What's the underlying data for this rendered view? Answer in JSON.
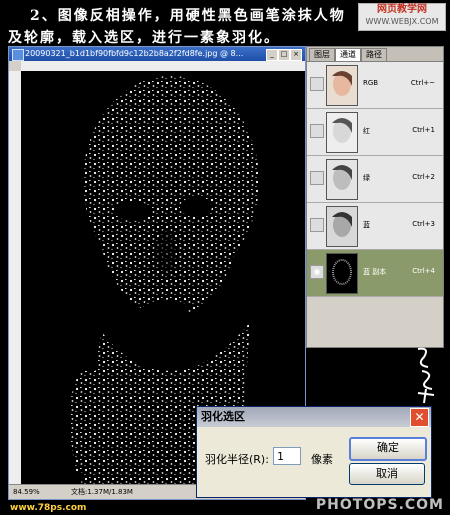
{
  "instruction": {
    "line1": "2、图像反相操作，用硬性黑色画笔涂抹人物",
    "line2": "及轮廓，载入选区，进行一素象羽化。"
  },
  "watermarks": {
    "top_site": "网页教学网",
    "top_url": "WWW.WEBJX.COM",
    "bottom_left": "www.78ps.com",
    "bottom_right": "PHOTOPS.COM"
  },
  "image_window": {
    "title": "20090321_b1d1bf90fbfd9c12b2b8a2f2fd8fe.jpg @ 8...",
    "zoom": "84.59%",
    "doc_info": "文档:1.37M/1.83M"
  },
  "channels_panel": {
    "tabs": [
      "图层",
      "通道",
      "路径"
    ],
    "active_tab": 1,
    "channels": [
      {
        "name": "RGB",
        "shortcut": "Ctrl+~",
        "selected": false
      },
      {
        "name": "红",
        "shortcut": "Ctrl+1",
        "selected": false
      },
      {
        "name": "绿",
        "shortcut": "Ctrl+2",
        "selected": false
      },
      {
        "name": "蓝",
        "shortcut": "Ctrl+3",
        "selected": false
      },
      {
        "name": "蓝 副本",
        "shortcut": "Ctrl+4",
        "selected": true
      }
    ]
  },
  "feather_dialog": {
    "title": "羽化选区",
    "radius_label": "羽化半径(R):",
    "radius_value": "1",
    "unit": "像素",
    "ok_label": "确定",
    "cancel_label": "取消"
  },
  "colors": {
    "selected_channel": "#8a9a6a",
    "dialog_border": "#0a246a"
  }
}
